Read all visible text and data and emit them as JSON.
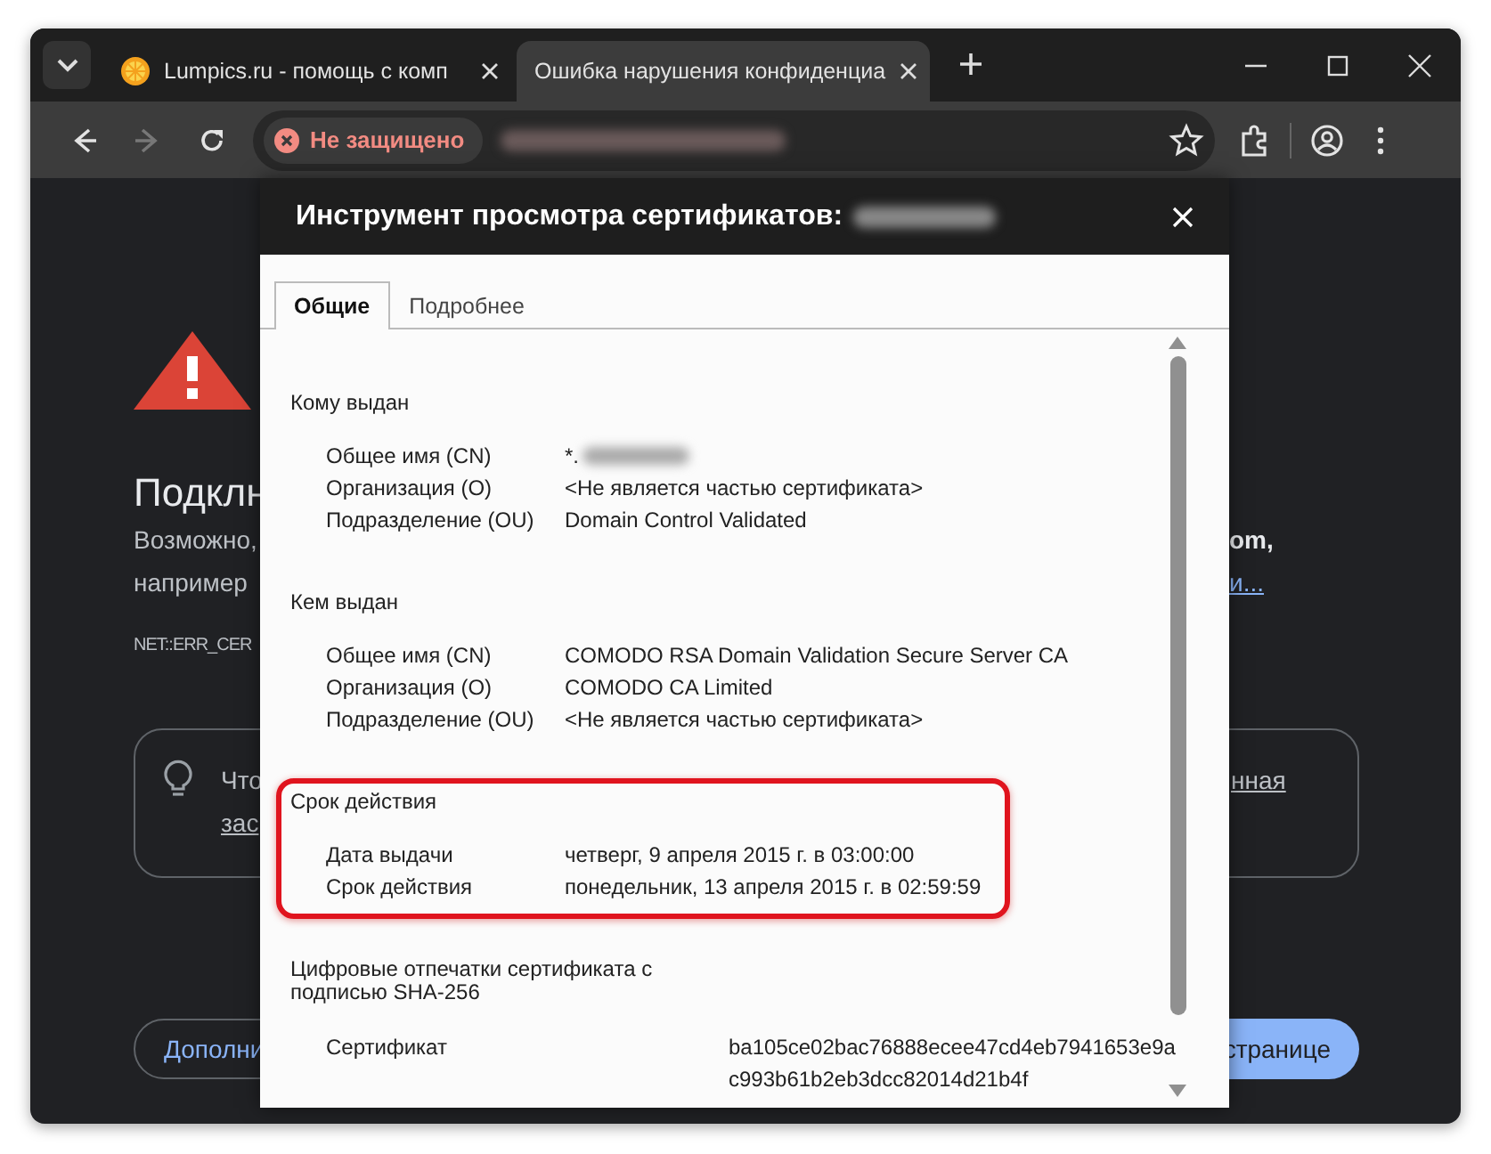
{
  "browser": {
    "tabs": [
      {
        "kind": "site",
        "title": "Lumpics.ru - помощь с комп",
        "selected": false
      },
      {
        "kind": "error",
        "title": "Ошибка нарушения конфиденциа",
        "selected": true
      }
    ],
    "nav": [
      {
        "kind": "back",
        "disabled": false
      },
      {
        "kind": "forward",
        "disabled": true
      },
      {
        "kind": "reload",
        "disabled": false
      }
    ],
    "security_chip": "Не защищено",
    "url_redacted": true
  },
  "page": {
    "heading": "Подклн",
    "lines": [
      {
        "left": "Возможно,",
        "right": "om,",
        "right_is_link": false
      },
      {
        "left": "например",
        "right": "и...",
        "right_is_link": true
      }
    ],
    "error_code": "NET::ERR_CER",
    "card": {
      "text": "Что",
      "link": "зас",
      "right_link": "нная"
    },
    "buttons": [
      {
        "kind": "secondary",
        "label": "Дополни"
      },
      {
        "kind": "primary",
        "label": "странице"
      }
    ]
  },
  "dialog": {
    "title": "Инструмент просмотра сертификатов:",
    "title_redacted": true,
    "tabs": [
      {
        "label": "Общие",
        "selected": true
      },
      {
        "label": "Подробнее",
        "selected": false
      }
    ],
    "sections": [
      {
        "heading": [
          "Кому выдан"
        ],
        "highlighted": false,
        "rows": [
          {
            "label": "Общее имя (CN)",
            "value": [
              "*."
            ],
            "redacted": true
          },
          {
            "label": "Организация (O)",
            "value": [
              "<Не является частью сертификата>"
            ],
            "redacted": false
          },
          {
            "label": "Подразделение (OU)",
            "value": [
              "Domain Control Validated"
            ],
            "redacted": false
          }
        ]
      },
      {
        "heading": [
          "Кем выдан"
        ],
        "highlighted": false,
        "rows": [
          {
            "label": "Общее имя (CN)",
            "value": [
              "COMODO RSA Domain Validation Secure Server CA"
            ],
            "redacted": false
          },
          {
            "label": "Организация (O)",
            "value": [
              "COMODO CA Limited"
            ],
            "redacted": false
          },
          {
            "label": "Подразделение (OU)",
            "value": [
              "<Не является частью сертификата>"
            ],
            "redacted": false
          }
        ]
      },
      {
        "heading": [
          "Срок действия"
        ],
        "highlighted": true,
        "rows": [
          {
            "label": "Дата выдачи",
            "value": [
              "четверг, 9 апреля 2015 г. в 03:00:00"
            ],
            "redacted": false
          },
          {
            "label": "Срок действия",
            "value": [
              "понедельник, 13 апреля 2015 г. в 02:59:59"
            ],
            "redacted": false
          }
        ]
      },
      {
        "heading": [
          "Цифровые отпечатки сертификата с",
          "подписью SHA-256"
        ],
        "highlighted": false,
        "rows": [
          {
            "label": "Сертификат",
            "value": [
              "ba105ce02bac76888ecee47cd4eb7941653e9a",
              "c993b61b2eb3dcc82014d21b4f"
            ],
            "redacted": false
          }
        ]
      }
    ]
  }
}
